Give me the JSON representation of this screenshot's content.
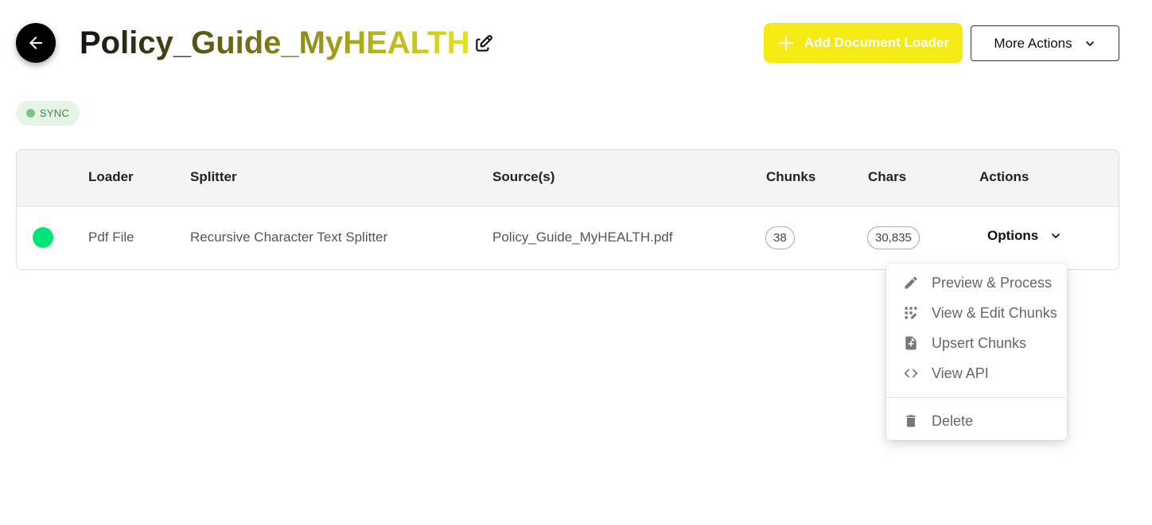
{
  "header": {
    "title": "Policy_Guide_MyHEALTH",
    "back_icon": "arrow-left-icon",
    "edit_icon": "pencil-square-icon",
    "add_button_label": "Add Document Loader",
    "more_button_label": "More Actions",
    "accent_color": "#f5ea14"
  },
  "status_badge": {
    "label": "SYNC",
    "color": "#7bc47f"
  },
  "table": {
    "columns": [
      "",
      "Loader",
      "Splitter",
      "Source(s)",
      "Chunks",
      "Chars",
      "Actions"
    ],
    "rows": [
      {
        "status_color": "#00e676",
        "loader": "Pdf File",
        "splitter": "Recursive Character Text Splitter",
        "source": "Policy_Guide_MyHEALTH.pdf",
        "chunks": "38",
        "chars": "30,835",
        "actions_label": "Options"
      }
    ]
  },
  "options_menu": {
    "items": [
      {
        "label": "Preview & Process",
        "icon": "pencil-icon"
      },
      {
        "label": "View & Edit Chunks",
        "icon": "grid-edit-icon"
      },
      {
        "label": "Upsert Chunks",
        "icon": "file-add-icon"
      },
      {
        "label": "View API",
        "icon": "code-icon"
      },
      {
        "label": "Delete",
        "icon": "trash-icon"
      }
    ]
  }
}
